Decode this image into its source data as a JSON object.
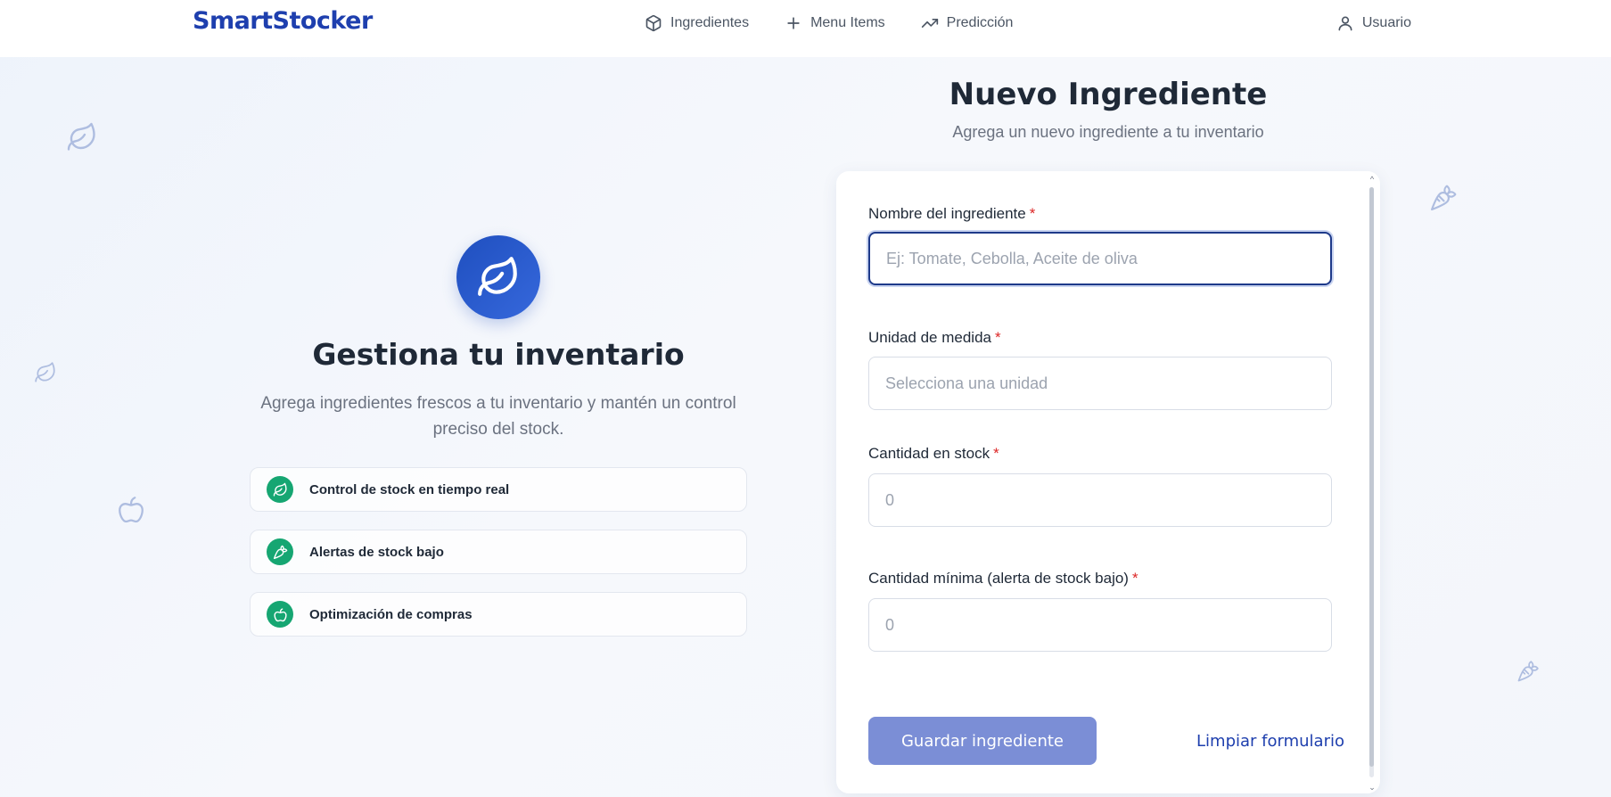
{
  "header": {
    "brand": "SmartStocker",
    "nav": [
      {
        "label": "Ingredientes",
        "icon": "box-icon"
      },
      {
        "label": "Menu Items",
        "icon": "plus-icon"
      },
      {
        "label": "Predicción",
        "icon": "trending-up-icon"
      }
    ],
    "user_label": "Usuario"
  },
  "hero": {
    "title": "Gestiona tu inventario",
    "subtitle": "Agrega ingredientes frescos a tu inventario y mantén un control preciso del stock.",
    "features": [
      {
        "label": "Control de stock en tiempo real",
        "icon": "leaf-icon"
      },
      {
        "label": "Alertas de stock bajo",
        "icon": "carrot-icon"
      },
      {
        "label": "Optimización de compras",
        "icon": "apple-icon"
      }
    ]
  },
  "form": {
    "title": "Nuevo Ingrediente",
    "subtitle": "Agrega un nuevo ingrediente a tu inventario",
    "required_mark": "*",
    "name": {
      "label": "Nombre del ingrediente",
      "placeholder": "Ej: Tomate, Cebolla, Aceite de oliva",
      "value": ""
    },
    "unit": {
      "label": "Unidad de medida",
      "placeholder": "Selecciona una unidad"
    },
    "stock": {
      "label": "Cantidad en stock",
      "placeholder": "0",
      "value": ""
    },
    "min_stock": {
      "label": "Cantidad mínima (alerta de stock bajo)",
      "placeholder": "0",
      "value": ""
    },
    "save_label": "Guardar ingrediente",
    "clear_label": "Limpiar formulario"
  },
  "colors": {
    "brand": "#1e3fae",
    "accent_green": "#16a672",
    "button_disabled": "#7b8ed6",
    "required": "#dc2626"
  }
}
